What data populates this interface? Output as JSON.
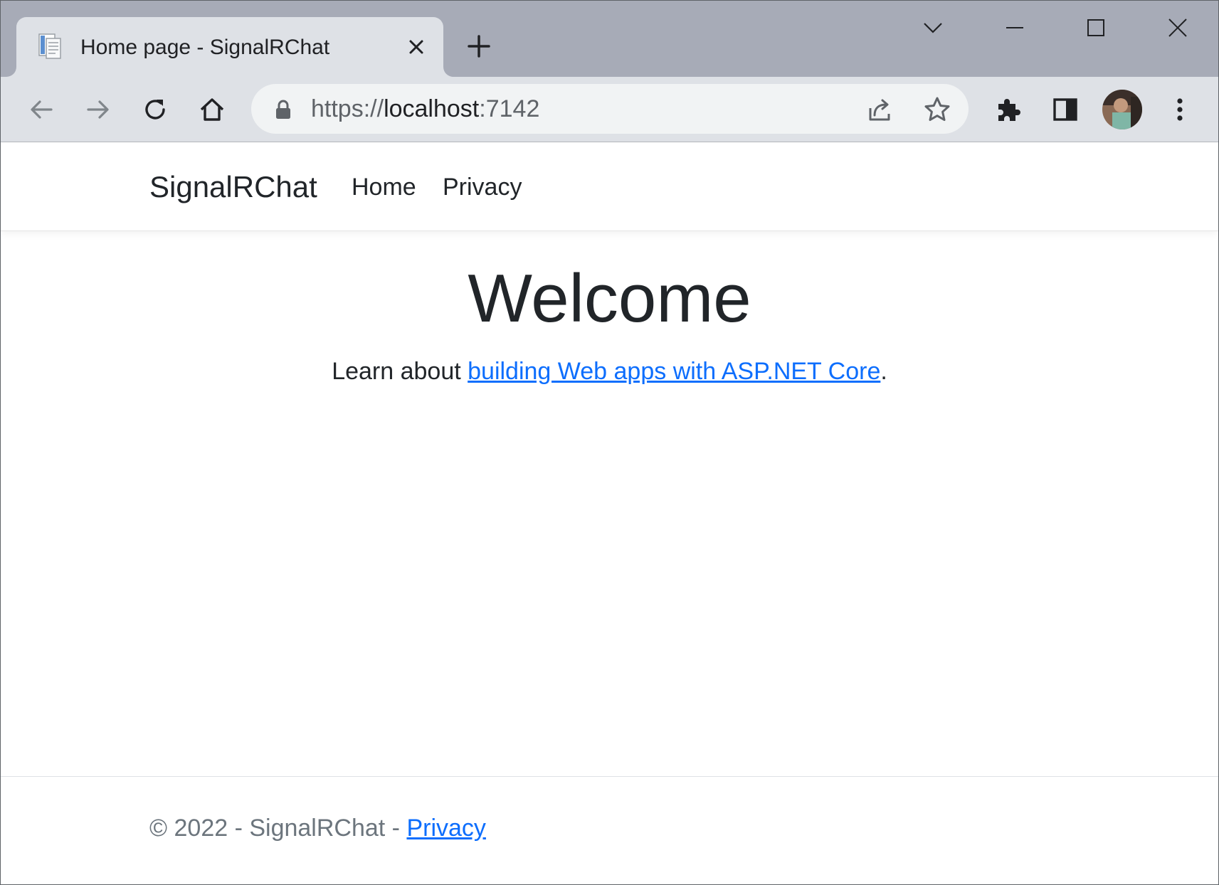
{
  "browser": {
    "tab": {
      "title": "Home page - SignalRChat",
      "favicon": "page-favicon-icon"
    },
    "omnibox": {
      "url_scheme": "https://",
      "url_host": "localhost",
      "url_port": ":7142"
    },
    "icons": {
      "back": "back-arrow-icon",
      "forward": "forward-arrow-icon",
      "reload": "reload-icon",
      "home": "home-icon",
      "lock": "lock-icon",
      "share": "share-icon",
      "bookmark": "star-icon",
      "extensions": "puzzle-icon",
      "side_panel": "side-panel-icon",
      "menu": "kebab-menu-icon"
    },
    "colors": {
      "tabstrip": "#a7abb7",
      "toolbar": "#dee1e6",
      "omnibox": "#f1f3f4"
    }
  },
  "site": {
    "navbar": {
      "brand": "SignalRChat",
      "links": [
        {
          "label": "Home"
        },
        {
          "label": "Privacy"
        }
      ]
    },
    "main": {
      "heading": "Welcome",
      "learn_prefix": "Learn about ",
      "learn_link": "building Web apps with ASP.NET Core",
      "learn_suffix": "."
    },
    "footer": {
      "text": "© 2022 - SignalRChat - ",
      "link": "Privacy"
    },
    "colors": {
      "link": "#0d6efd",
      "text": "#212529",
      "muted": "#6c757d"
    }
  }
}
